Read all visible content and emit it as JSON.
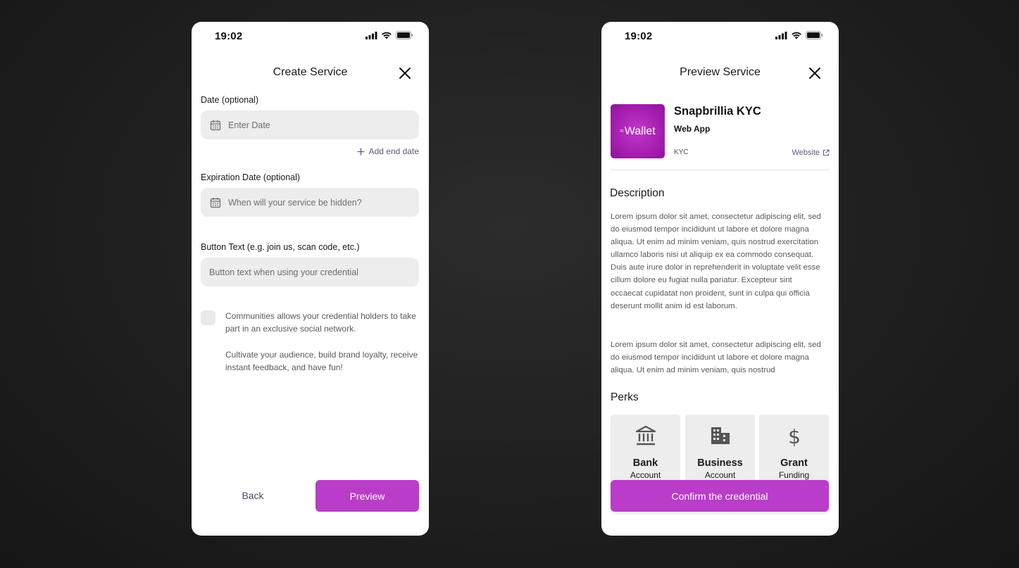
{
  "colors": {
    "accent": "#b93dc8",
    "link": "#5b5b82",
    "input_bg": "#ededed"
  },
  "create_screen": {
    "status_time": "19:02",
    "title": "Create Service",
    "date_label": "Date (optional)",
    "date_placeholder": "Enter Date",
    "add_end_date": "Add end date",
    "expiration_label": "Expiration Date (optional)",
    "expiration_placeholder": "When will your service be hidden?",
    "button_text_label": "Button Text (e.g. join us, scan code, etc.)",
    "button_text_placeholder": "Button text when using your credential",
    "communities_text_1": "Communities allows your credential holders to take part in an exclusive social network.",
    "communities_text_2": "Cultivate your audience, build brand loyalty, receive instant feedback, and have fun!",
    "back_label": "Back",
    "preview_label": "Preview"
  },
  "preview_screen": {
    "status_time": "19:02",
    "title": "Preview Service",
    "logo_text": "Wallet",
    "app_name": "Snapbrillia KYC",
    "app_type": "Web App",
    "app_category": "KYC",
    "website_label": "Website",
    "description_title": "Description",
    "description_p1": "Lorem ipsum dolor sit amet, consectetur adipiscing elit, sed do eiusmod tempor incididunt ut labore et dolore magna aliqua. Ut enim ad minim veniam, quis nostrud exercitation ullamco laboris nisi ut aliquip ex ea commodo consequat. Duis aute irure dolor in reprehenderit in voluptate velit esse cillum dolore eu fugiat nulla pariatur. Excepteur sint occaecat cupidatat non proident, sunt in culpa qui officia deserunt mollit anim id est laborum.",
    "description_p2": "Lorem ipsum dolor sit amet, consectetur adipiscing elit, sed do eiusmod tempor incididunt ut labore et dolore magna aliqua. Ut enim ad minim veniam, quis nostrud",
    "perks_title": "Perks",
    "perks": [
      {
        "icon": "bank-icon",
        "title": "Bank",
        "subtitle": "Account"
      },
      {
        "icon": "building-icon",
        "title": "Business",
        "subtitle": "Account"
      },
      {
        "icon": "dollar-icon",
        "title": "Grant",
        "subtitle": "Funding"
      }
    ],
    "confirm_label": "Confirm the credential"
  }
}
